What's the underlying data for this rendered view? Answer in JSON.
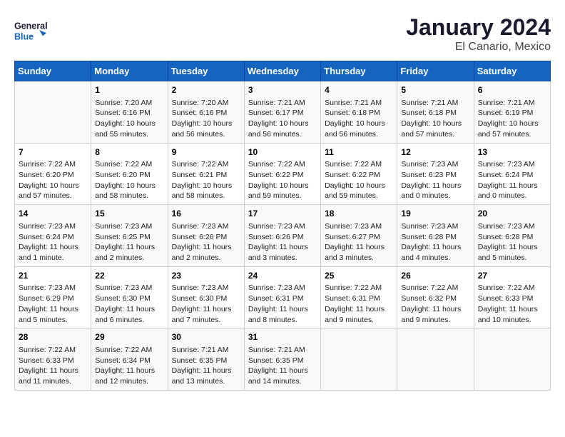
{
  "header": {
    "logo_line1": "General",
    "logo_line2": "Blue",
    "title": "January 2024",
    "subtitle": "El Canario, Mexico"
  },
  "columns": [
    "Sunday",
    "Monday",
    "Tuesday",
    "Wednesday",
    "Thursday",
    "Friday",
    "Saturday"
  ],
  "weeks": [
    [
      {
        "day": "",
        "info": ""
      },
      {
        "day": "1",
        "info": "Sunrise: 7:20 AM\nSunset: 6:16 PM\nDaylight: 10 hours\nand 55 minutes."
      },
      {
        "day": "2",
        "info": "Sunrise: 7:20 AM\nSunset: 6:16 PM\nDaylight: 10 hours\nand 56 minutes."
      },
      {
        "day": "3",
        "info": "Sunrise: 7:21 AM\nSunset: 6:17 PM\nDaylight: 10 hours\nand 56 minutes."
      },
      {
        "day": "4",
        "info": "Sunrise: 7:21 AM\nSunset: 6:18 PM\nDaylight: 10 hours\nand 56 minutes."
      },
      {
        "day": "5",
        "info": "Sunrise: 7:21 AM\nSunset: 6:18 PM\nDaylight: 10 hours\nand 57 minutes."
      },
      {
        "day": "6",
        "info": "Sunrise: 7:21 AM\nSunset: 6:19 PM\nDaylight: 10 hours\nand 57 minutes."
      }
    ],
    [
      {
        "day": "7",
        "info": "Sunrise: 7:22 AM\nSunset: 6:20 PM\nDaylight: 10 hours\nand 57 minutes."
      },
      {
        "day": "8",
        "info": "Sunrise: 7:22 AM\nSunset: 6:20 PM\nDaylight: 10 hours\nand 58 minutes."
      },
      {
        "day": "9",
        "info": "Sunrise: 7:22 AM\nSunset: 6:21 PM\nDaylight: 10 hours\nand 58 minutes."
      },
      {
        "day": "10",
        "info": "Sunrise: 7:22 AM\nSunset: 6:22 PM\nDaylight: 10 hours\nand 59 minutes."
      },
      {
        "day": "11",
        "info": "Sunrise: 7:22 AM\nSunset: 6:22 PM\nDaylight: 10 hours\nand 59 minutes."
      },
      {
        "day": "12",
        "info": "Sunrise: 7:23 AM\nSunset: 6:23 PM\nDaylight: 11 hours\nand 0 minutes."
      },
      {
        "day": "13",
        "info": "Sunrise: 7:23 AM\nSunset: 6:24 PM\nDaylight: 11 hours\nand 0 minutes."
      }
    ],
    [
      {
        "day": "14",
        "info": "Sunrise: 7:23 AM\nSunset: 6:24 PM\nDaylight: 11 hours\nand 1 minute."
      },
      {
        "day": "15",
        "info": "Sunrise: 7:23 AM\nSunset: 6:25 PM\nDaylight: 11 hours\nand 2 minutes."
      },
      {
        "day": "16",
        "info": "Sunrise: 7:23 AM\nSunset: 6:26 PM\nDaylight: 11 hours\nand 2 minutes."
      },
      {
        "day": "17",
        "info": "Sunrise: 7:23 AM\nSunset: 6:26 PM\nDaylight: 11 hours\nand 3 minutes."
      },
      {
        "day": "18",
        "info": "Sunrise: 7:23 AM\nSunset: 6:27 PM\nDaylight: 11 hours\nand 3 minutes."
      },
      {
        "day": "19",
        "info": "Sunrise: 7:23 AM\nSunset: 6:28 PM\nDaylight: 11 hours\nand 4 minutes."
      },
      {
        "day": "20",
        "info": "Sunrise: 7:23 AM\nSunset: 6:28 PM\nDaylight: 11 hours\nand 5 minutes."
      }
    ],
    [
      {
        "day": "21",
        "info": "Sunrise: 7:23 AM\nSunset: 6:29 PM\nDaylight: 11 hours\nand 5 minutes."
      },
      {
        "day": "22",
        "info": "Sunrise: 7:23 AM\nSunset: 6:30 PM\nDaylight: 11 hours\nand 6 minutes."
      },
      {
        "day": "23",
        "info": "Sunrise: 7:23 AM\nSunset: 6:30 PM\nDaylight: 11 hours\nand 7 minutes."
      },
      {
        "day": "24",
        "info": "Sunrise: 7:23 AM\nSunset: 6:31 PM\nDaylight: 11 hours\nand 8 minutes."
      },
      {
        "day": "25",
        "info": "Sunrise: 7:22 AM\nSunset: 6:31 PM\nDaylight: 11 hours\nand 9 minutes."
      },
      {
        "day": "26",
        "info": "Sunrise: 7:22 AM\nSunset: 6:32 PM\nDaylight: 11 hours\nand 9 minutes."
      },
      {
        "day": "27",
        "info": "Sunrise: 7:22 AM\nSunset: 6:33 PM\nDaylight: 11 hours\nand 10 minutes."
      }
    ],
    [
      {
        "day": "28",
        "info": "Sunrise: 7:22 AM\nSunset: 6:33 PM\nDaylight: 11 hours\nand 11 minutes."
      },
      {
        "day": "29",
        "info": "Sunrise: 7:22 AM\nSunset: 6:34 PM\nDaylight: 11 hours\nand 12 minutes."
      },
      {
        "day": "30",
        "info": "Sunrise: 7:21 AM\nSunset: 6:35 PM\nDaylight: 11 hours\nand 13 minutes."
      },
      {
        "day": "31",
        "info": "Sunrise: 7:21 AM\nSunset: 6:35 PM\nDaylight: 11 hours\nand 14 minutes."
      },
      {
        "day": "",
        "info": ""
      },
      {
        "day": "",
        "info": ""
      },
      {
        "day": "",
        "info": ""
      }
    ]
  ]
}
